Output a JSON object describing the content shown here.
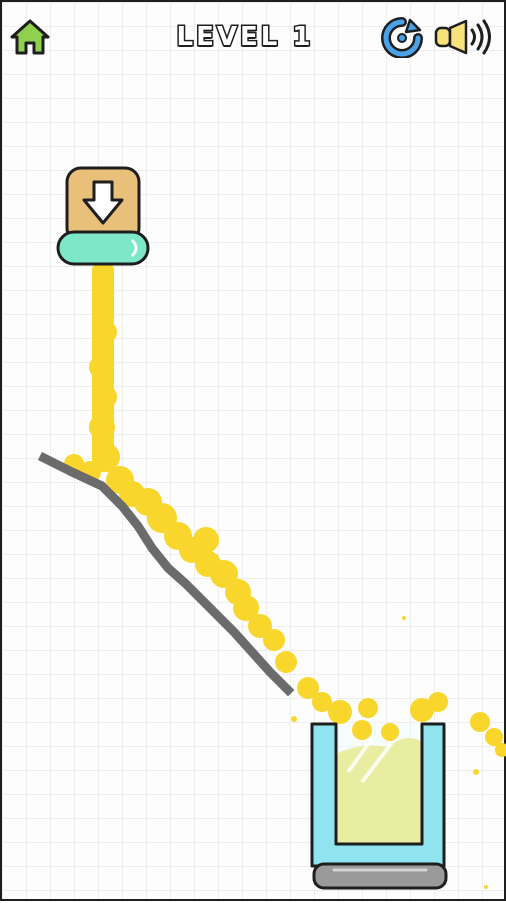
{
  "hud": {
    "title": "LEVEL 1",
    "home_icon": "home-icon",
    "restart_icon": "restart-icon",
    "sound_icon": "sound-on-icon"
  },
  "colors": {
    "liquid": "#f8d62c",
    "tap_top": "#e8c07a",
    "tap_nozzle": "#7de8c8",
    "glass_frame": "#8fe4f0",
    "glass_base": "#9a9a9a",
    "drawn_line": "#6b6b6b",
    "home_green": "#8fd14f",
    "restart_blue": "#4aa3e8"
  },
  "game": {
    "faucet_icon": "arrow-down-icon",
    "glass_fill_level": 0.75
  }
}
